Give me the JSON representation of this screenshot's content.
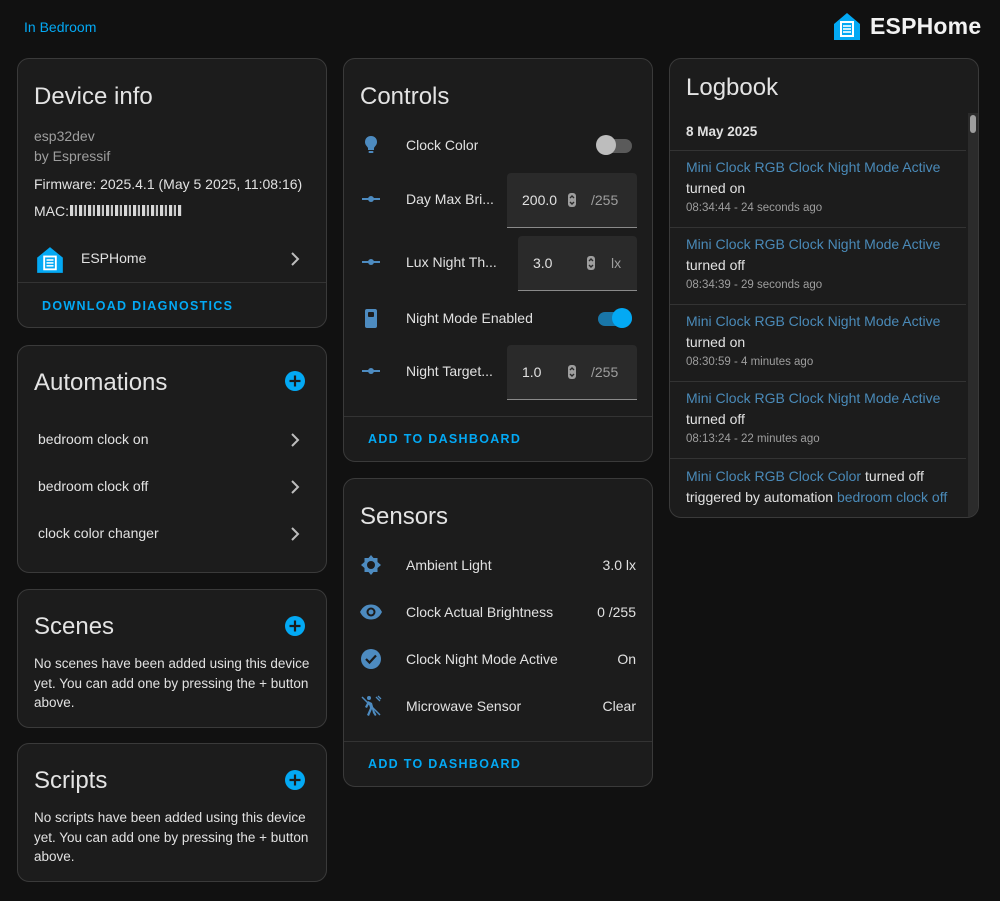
{
  "header": {
    "area_link": "In Bedroom",
    "brand_name": "ESPHome",
    "brand_color": "#03a9f4"
  },
  "device_info": {
    "title": "Device info",
    "model": "esp32dev",
    "manufacturer": "by Espressif",
    "firmware": "Firmware: 2025.4.1 (May 5 2025, 11:08:16)",
    "mac_label": "MAC:",
    "integration_name": "ESPHome",
    "integration_icon": "esphome-logo-icon",
    "download_label": "Download diagnostics"
  },
  "automations": {
    "title": "Automations",
    "items": [
      "bedroom clock on",
      "bedroom clock off",
      "clock color changer"
    ]
  },
  "scenes": {
    "title": "Scenes",
    "empty_text": "No scenes have been added using this device yet. You can add one by pressing the + button above."
  },
  "scripts": {
    "title": "Scripts",
    "empty_text": "No scripts have been added using this device yet. You can add one by pressing the + button above."
  },
  "controls": {
    "title": "Controls",
    "rows": [
      {
        "icon": "lightbulb-icon",
        "label": "Clock Color",
        "type": "toggle",
        "checked": false
      },
      {
        "icon": "slider-icon",
        "label": "Day Max Bri...",
        "type": "number",
        "value": "200.0",
        "unit": "/255"
      },
      {
        "icon": "slider-icon",
        "label": "Lux Night Th...",
        "type": "number",
        "value": "3.0",
        "unit": "lx"
      },
      {
        "icon": "switch-icon",
        "label": "Night Mode Enabled",
        "type": "toggle",
        "checked": true
      },
      {
        "icon": "slider-icon",
        "label": "Night Target...",
        "type": "number",
        "value": "1.0",
        "unit": "/255"
      }
    ],
    "add_label": "Add to dashboard"
  },
  "sensors": {
    "title": "Sensors",
    "rows": [
      {
        "icon": "brightness-icon",
        "label": "Ambient Light",
        "value": "3.0 lx"
      },
      {
        "icon": "eye-icon",
        "label": "Clock Actual Brightness",
        "value": "0 /255"
      },
      {
        "icon": "check-circle-icon",
        "label": "Clock Night Mode Active",
        "value": "On"
      },
      {
        "icon": "motion-sensor-icon",
        "label": "Microwave Sensor",
        "value": "Clear"
      }
    ],
    "add_label": "Add to dashboard"
  },
  "logbook": {
    "title": "Logbook",
    "date": "8 May 2025",
    "entries": [
      {
        "name": "Mini Clock RGB Clock Night Mode Active",
        "state": "turned on",
        "time": "08:34:44 - 24 seconds ago"
      },
      {
        "name": "Mini Clock RGB Clock Night Mode Active",
        "state": "turned off",
        "time": "08:34:39 - 29 seconds ago"
      },
      {
        "name": "Mini Clock RGB Clock Night Mode Active",
        "state": "turned on",
        "time": "08:30:59 - 4 minutes ago"
      },
      {
        "name": "Mini Clock RGB Clock Night Mode Active",
        "state": "turned off",
        "time": "08:13:24 - 22 minutes ago"
      }
    ],
    "last_entry": {
      "name": "Mini Clock RGB Clock Color",
      "state": "turned off",
      "trigger_text": "triggered by automation",
      "trigger_link": "bedroom clock off"
    }
  }
}
